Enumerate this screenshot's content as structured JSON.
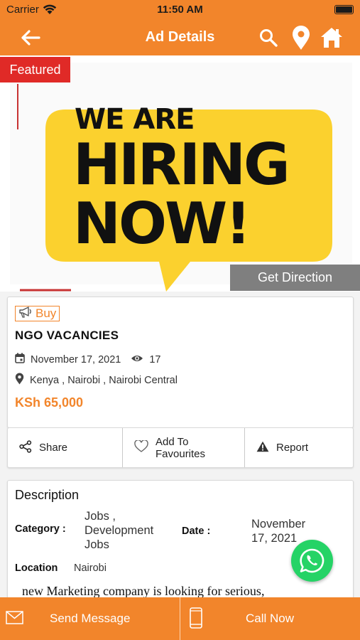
{
  "status_bar": {
    "carrier": "Carrier",
    "time": "11:50 AM"
  },
  "nav": {
    "title": "Ad Details"
  },
  "hero": {
    "badge": "Featured",
    "poster_lines": [
      "WE ARE",
      "HIRING",
      "NOW!"
    ],
    "direction_label": "Get Direction"
  },
  "ad": {
    "type": "Buy",
    "title": "NGO VACANCIES",
    "date": "November 17, 2021",
    "views": "17",
    "location": "Kenya , Nairobi , Nairobi Central",
    "price": "KSh 65,000"
  },
  "actions": {
    "share": "Share",
    "favourite_line1": "Add To",
    "favourite_line2": "Favourites",
    "report": "Report"
  },
  "description": {
    "heading": "Description",
    "category_label": "Category :",
    "category_line1": "Jobs ,",
    "category_line2": "Development",
    "category_line3": "Jobs",
    "date_label": "Date :",
    "date_line1": "November",
    "date_line2": "17, 2021",
    "location_label": "Location",
    "location_value": "Nairobi",
    "body": "new Marketing company is looking for serious,"
  },
  "bottom_bar": {
    "message": "Send Message",
    "call": "Call Now"
  },
  "colors": {
    "accent": "#f2852b",
    "featured": "#e02a27",
    "whatsapp": "#25d366",
    "poster_yellow": "#fbd12e"
  }
}
